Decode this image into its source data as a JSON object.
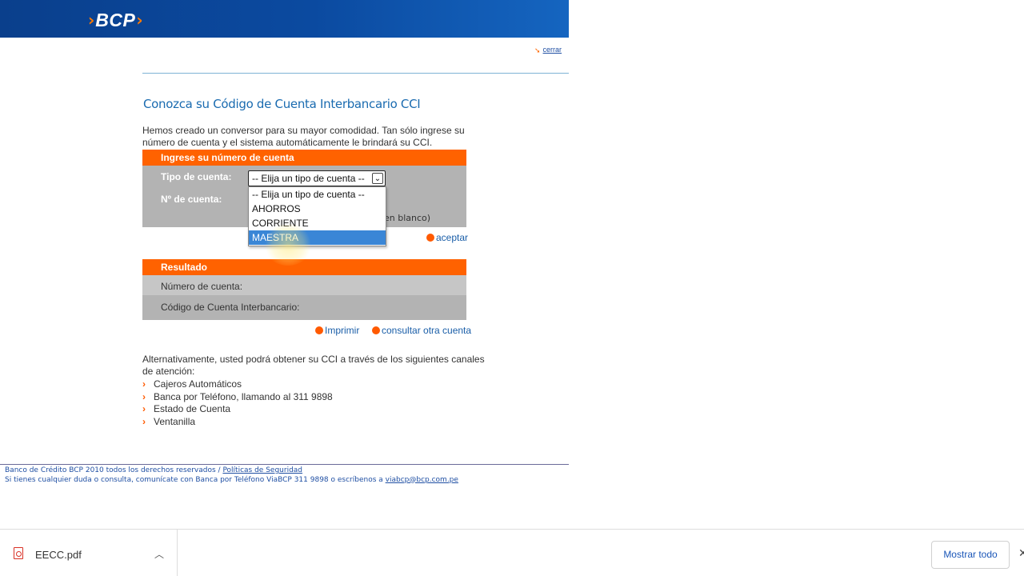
{
  "header": {
    "logo_left": "›",
    "logo_text": "BCP",
    "logo_right": "›",
    "close_label": "cerrar"
  },
  "page_title": "Conozca su Código de Cuenta Interbancario CCI",
  "intro": "Hemos creado un conversor para su mayor comodidad. Tan sólo ingrese su número de cuenta y el sistema automáticamente le brindará su CCI.",
  "input_section": {
    "heading": "Ingrese su número de cuenta",
    "tipo_label": "Tipo de cuenta:",
    "numero_label": "Nº de cuenta:",
    "select_value": "-- Elija un tipo de cuenta --",
    "hint": "en blanco)",
    "options": [
      "-- Elija un tipo de cuenta --",
      "AHORROS",
      "CORRIENTE",
      "MAESTRA"
    ],
    "selected_option": "MAESTRA",
    "accept_label": "aceptar"
  },
  "result_section": {
    "heading": "Resultado",
    "cuenta_label": "Número de cuenta:",
    "cci_label": "Código de Cuenta Interbancario:",
    "print_label": "Imprimir",
    "other_label": "consultar otra cuenta"
  },
  "alternatives": {
    "text": "Alternativamente, usted podrá obtener su CCI a través de los siguientes canales de atención:",
    "items": [
      "Cajeros Automáticos",
      "Banca por Teléfono, llamando al 311 9898",
      "Estado de Cuenta",
      "Ventanilla"
    ]
  },
  "footer": {
    "line1_text": "Banco de Crédito BCP 2010 todos los derechos reservados / ",
    "line1_link": "Políticas de Seguridad",
    "line2_text": "Si tienes cualquier duda o consulta, comunícate con Banca por Teléfono ViaBCP 311 9898 o escríbenos a ",
    "line2_link": "viabcp@bcp.com.pe"
  },
  "download_bar": {
    "file_name": "EECC.pdf",
    "show_all": "Mostrar todo",
    "close_glyph": "✕"
  },
  "colors": {
    "brand_blue": "#0b4aa0",
    "accent_orange": "#ff6200",
    "link_blue": "#1a5ea8"
  },
  "icons": [
    "pdf-icon",
    "chevron-up-icon",
    "close-icon",
    "bullet-dot-icon",
    "chevron-right-icon"
  ]
}
